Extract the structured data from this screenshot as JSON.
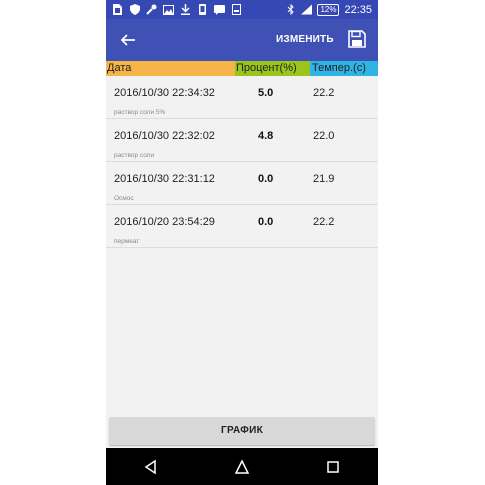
{
  "status_bar": {
    "time": "22:35",
    "battery": "12%",
    "icons": [
      "sim-icon",
      "shield-icon",
      "wrench-icon",
      "image-icon",
      "download-icon",
      "phone-icon",
      "message-icon",
      "sd-icon",
      "bluetooth-icon",
      "signal-icon",
      "battery-icon"
    ]
  },
  "toolbar": {
    "edit_label": "ИЗМЕНИТЬ",
    "background": "#3f51b5"
  },
  "table": {
    "headers": {
      "date": "Дата",
      "percent": "Процент(%)",
      "temp": "Темпер.(c)"
    },
    "header_colors": {
      "date": "#f5b548",
      "percent": "#9ac51d",
      "temp": "#2fb4e6"
    },
    "rows": [
      {
        "date": "2016/10/30 22:34:32",
        "percent": "5.0",
        "temp": "22.2",
        "note": "раствор соли 5%"
      },
      {
        "date": "2016/10/30 22:32:02",
        "percent": "4.8",
        "temp": "22.0",
        "note": "раствор соли"
      },
      {
        "date": "2016/10/30 22:31:12",
        "percent": "0.0",
        "temp": "21.9",
        "note": "Осмос"
      },
      {
        "date": "2016/10/20 23:54:29",
        "percent": "0.0",
        "temp": "22.2",
        "note": "пермеат"
      }
    ]
  },
  "graph_button": {
    "label": "ГРАФИК"
  }
}
